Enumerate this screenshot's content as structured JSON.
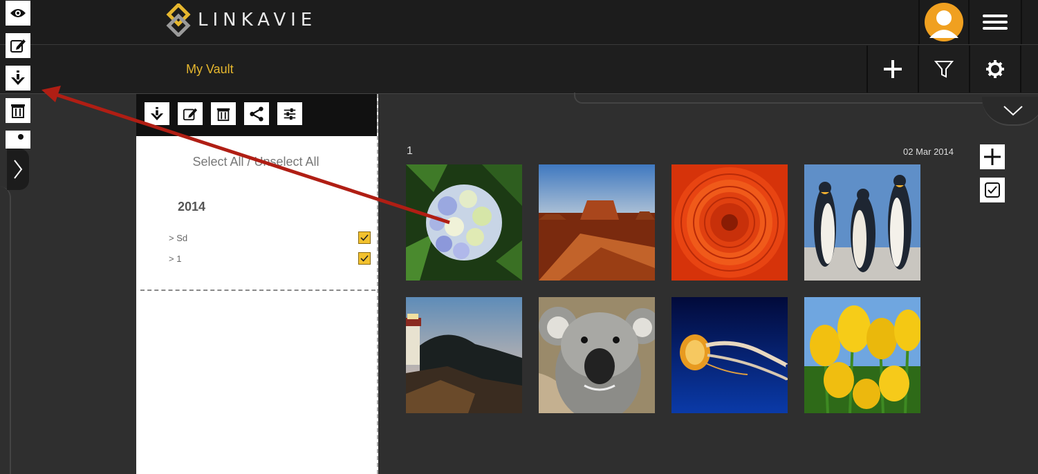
{
  "app": {
    "brand": "LINKAVIE"
  },
  "header": {
    "vault_title": "My Vault"
  },
  "panel": {
    "select_all_label": "Select All / Unselect All",
    "year": "2014",
    "albums": [
      {
        "label": "> Sd",
        "checked": true
      },
      {
        "label": "> 1",
        "checked": true
      }
    ]
  },
  "gallery": {
    "group_name": "1",
    "group_date": "02 Mar 2014",
    "photos": [
      "hydrangea",
      "desert",
      "chrysanthemum",
      "penguins",
      "lighthouse",
      "koala",
      "jellyfish",
      "tulips"
    ]
  },
  "colors": {
    "accent": "#e6b72e",
    "annotation_arrow": "#b01e14"
  }
}
